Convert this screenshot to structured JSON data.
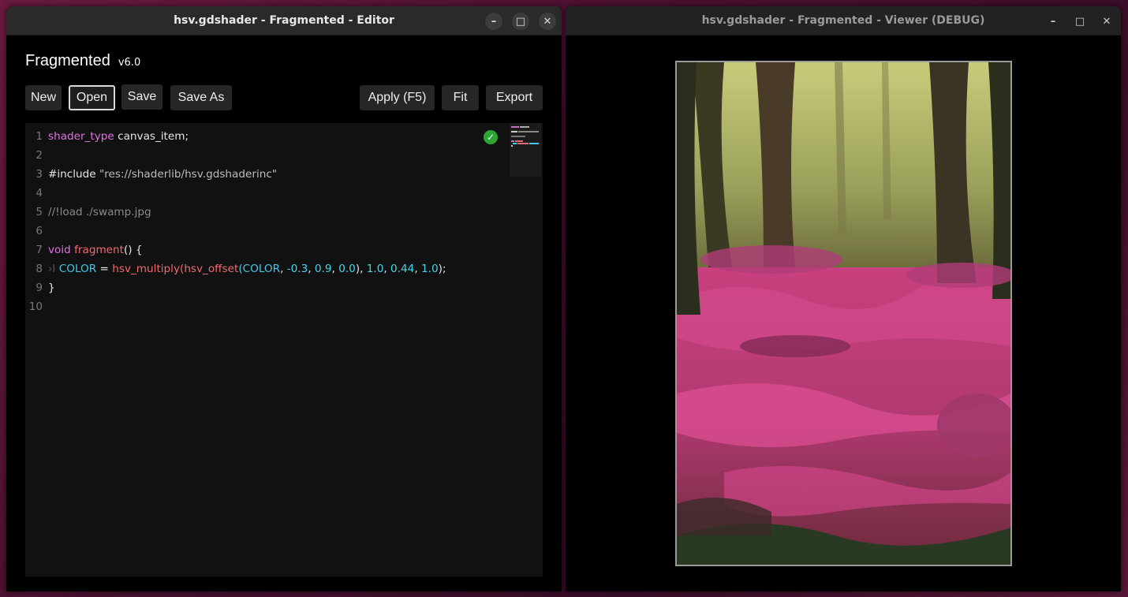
{
  "editor_window": {
    "title": "hsv.gdshader - Fragmented - Editor",
    "controls": [
      "–",
      "□",
      "✕"
    ]
  },
  "viewer_window": {
    "title": "hsv.gdshader - Fragmented - Viewer (DEBUG)",
    "controls": [
      "–",
      "□",
      "✕"
    ]
  },
  "app": {
    "name": "Fragmented",
    "version": "v6.0"
  },
  "toolbar": {
    "new_label": "New",
    "open_label": "Open",
    "save_label": "Save",
    "save_as_label": "Save As",
    "apply_label": "Apply (F5)",
    "fit_label": "Fit",
    "export_label": "Export"
  },
  "code": {
    "line_numbers": [
      "1",
      "2",
      "3",
      "4",
      "5",
      "6",
      "7",
      "8",
      "9",
      "10"
    ],
    "l1": {
      "kw": "shader_type",
      "rest": " canvas_item;"
    },
    "l3": {
      "pre": "#include ",
      "str": "\"res://shaderlib/hsv.gdshaderinc\""
    },
    "l5": {
      "cmt": "//!load ./swamp.jpg"
    },
    "l7": {
      "kw": "void",
      "fn": "fragment",
      "rest": "() {"
    },
    "l8": {
      "tab": "›I ",
      "id1": "COLOR",
      "eq": " = ",
      "fn1": "hsv_multiply",
      "p1": "(",
      "fn2": "hsv_offset",
      "p2": "(",
      "id2": "COLOR",
      "c1": ", ",
      "n1": "-0.3",
      "c2": ", ",
      "n2": "0.9",
      "c3": ", ",
      "n3": "0.0",
      "p3": "), ",
      "n4": "1.0",
      "c4": ", ",
      "n5": "0.44",
      "c5": ", ",
      "n6": "1.0",
      "p4": ");"
    },
    "l9": {
      "rest": "}"
    }
  },
  "status": {
    "compile_ok_icon": "check-circle-icon",
    "color": "#2ca534"
  }
}
